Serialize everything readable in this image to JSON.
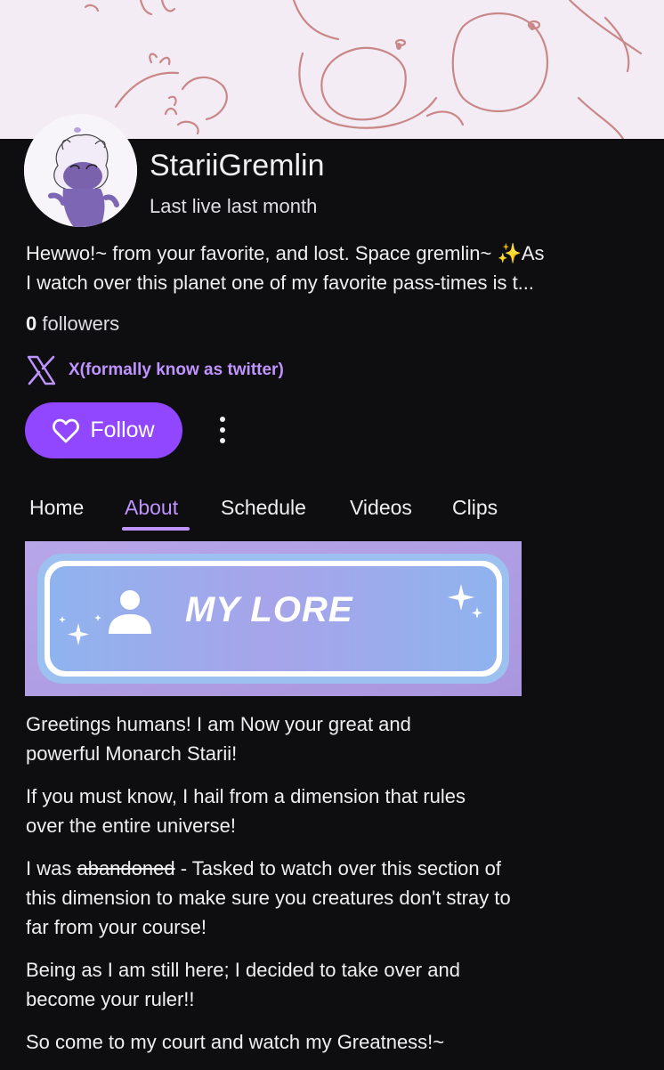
{
  "channel": {
    "name": "StariiGremlin",
    "last_live": "Last live last month",
    "bio_line1": "Hewwo!~ from your favorite, and lost. Space gremlin~ ✨As",
    "bio_line2": "I watch over this planet one of my favorite pass-times is t...",
    "followers_count": "0",
    "followers_label": "followers",
    "social_link": "X(formally know as twitter)"
  },
  "actions": {
    "follow_label": "Follow"
  },
  "tabs": [
    {
      "label": "Home",
      "active": false
    },
    {
      "label": "About",
      "active": true
    },
    {
      "label": "Schedule",
      "active": false
    },
    {
      "label": "Videos",
      "active": false
    },
    {
      "label": "Clips",
      "active": false
    }
  ],
  "panel": {
    "title": "MY LORE"
  },
  "about": {
    "p1": "Greetings humans! I am Now your great and powerful Monarch Starii!",
    "p2": "If you must know, I hail from a dimension that rules over the entire universe!",
    "p3_prefix": "I was ",
    "p3_struck": "abandoned",
    "p3_suffix": " - Tasked to watch over this section of this dimension to make sure you creatures don't stray to far from your course!",
    "p4": "Being as I am still here; I decided to take over and become your ruler!!",
    "p5": "So come to my court and watch my Greatness!~"
  },
  "colors": {
    "accent": "#9147ff",
    "accent_text": "#bf94ff",
    "background": "#0e0e10"
  }
}
